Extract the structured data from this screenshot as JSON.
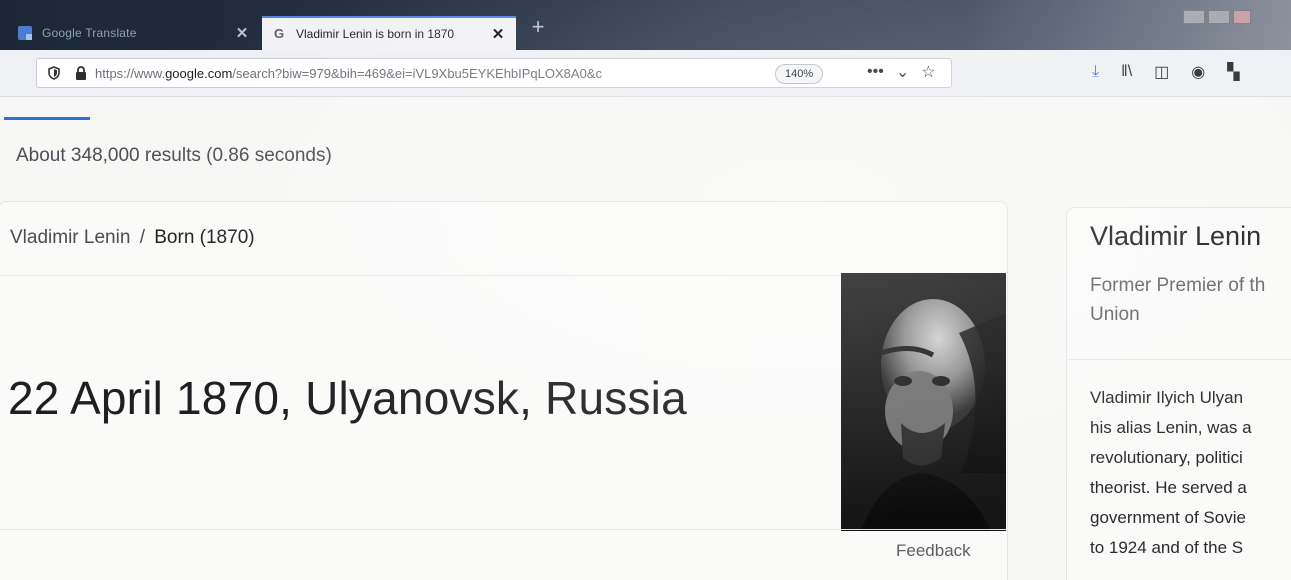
{
  "browser": {
    "tabs": [
      {
        "title": "Google Translate",
        "close_glyph": "✕",
        "active": false
      },
      {
        "title": "Vladimir Lenin is born in 1870",
        "close_glyph": "✕",
        "active": true
      }
    ],
    "new_tab_glyph": "+",
    "url": {
      "prefix": "https://www.",
      "domain": "google.com",
      "path": "/search?biw=979&bih=469&ei=iVL9Xbu5EYKEhbIPqLOX8A0&c"
    },
    "zoom": "140%",
    "url_actions": [
      "more-icon",
      "pocket-icon",
      "bookmark-star-icon"
    ],
    "toolbar_icons": [
      "download-icon",
      "library-icon",
      "sidebar-icon",
      "account-icon",
      "extensions-icon"
    ],
    "accent_color": "#2f6fd6"
  },
  "search": {
    "results_count": "About 348,000 results (0.86 seconds)"
  },
  "answer": {
    "breadcrumb_entity": "Vladimir Lenin",
    "breadcrumb_separator": "/",
    "breadcrumb_attribute": "Born (1870)",
    "value": "22 April 1870, Ulyanovsk, Russia",
    "feedback": "Feedback"
  },
  "knowledge_panel": {
    "title": "Vladimir Lenin",
    "subtitle_lines": [
      "Former Premier of th",
      "Union"
    ],
    "description_lines": [
      "Vladimir Ilyich Ulyan",
      "his alias Lenin, was a",
      "revolutionary, politici",
      "theorist. He served a",
      "government of Sovie",
      "to 1924 and of the S"
    ]
  }
}
